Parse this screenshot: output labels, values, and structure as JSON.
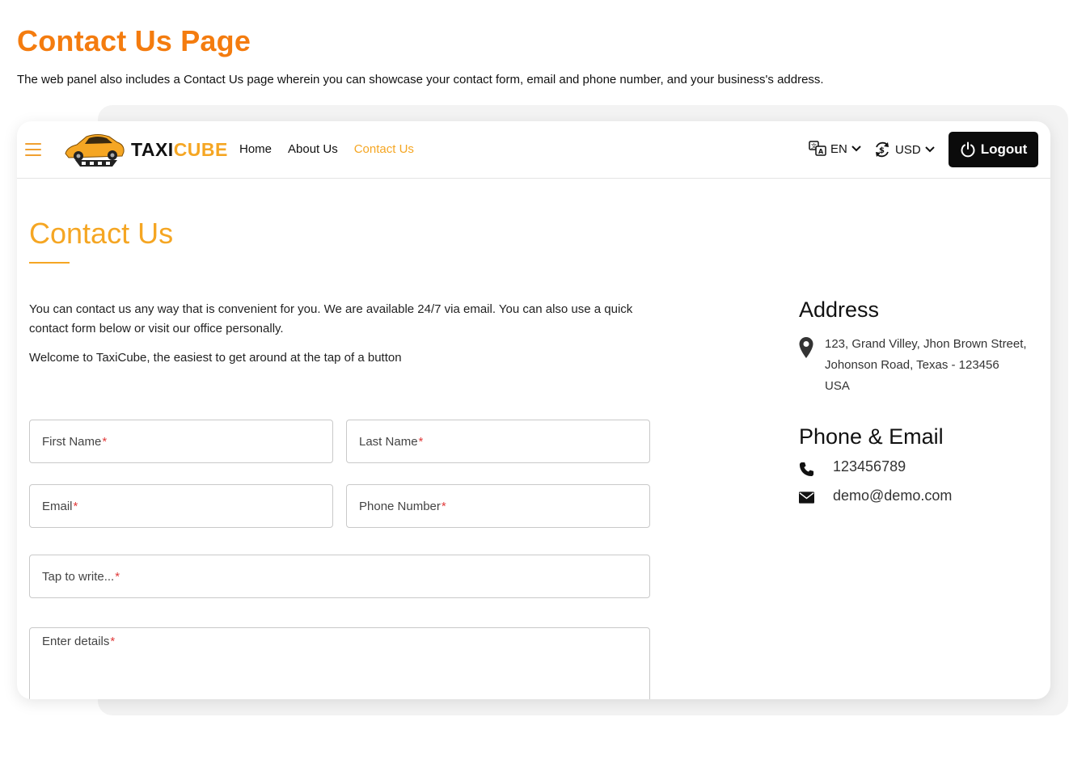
{
  "page": {
    "heading": "Contact Us Page",
    "description": "The web panel also includes a Contact Us page wherein you can showcase your contact form, email and phone number, and your business's address."
  },
  "navbar": {
    "logo_part1": "TAXI",
    "logo_part2": "CUBE",
    "links": [
      "Home",
      "About Us",
      "Contact Us"
    ],
    "active_link": "Contact Us",
    "language": "EN",
    "currency": "USD",
    "logout_label": "Logout"
  },
  "contact": {
    "title": "Contact Us",
    "intro": "You can contact us any way that is convenient for you. We are available 24/7 via email. You can also use a quick contact form below or visit our office personally.",
    "welcome": "Welcome to TaxiCube, the easiest to get around at the tap of a button"
  },
  "form": {
    "first_name": "First Name",
    "last_name": "Last Name",
    "email": "Email",
    "phone": "Phone Number",
    "subject": "Tap to write...",
    "details": "Enter details",
    "required_mark": "*"
  },
  "address": {
    "title": "Address",
    "line1": "123, Grand Villey, Jhon Brown Street,",
    "line2": "Johonson Road, Texas - 123456",
    "line3": "USA"
  },
  "phone_email": {
    "title": "Phone & Email",
    "phone": "123456789",
    "email": "demo@demo.com"
  },
  "colors": {
    "heading_orange": "#f47c0f",
    "accent": "#f5a623",
    "logout_bg": "#0b0b0b"
  }
}
